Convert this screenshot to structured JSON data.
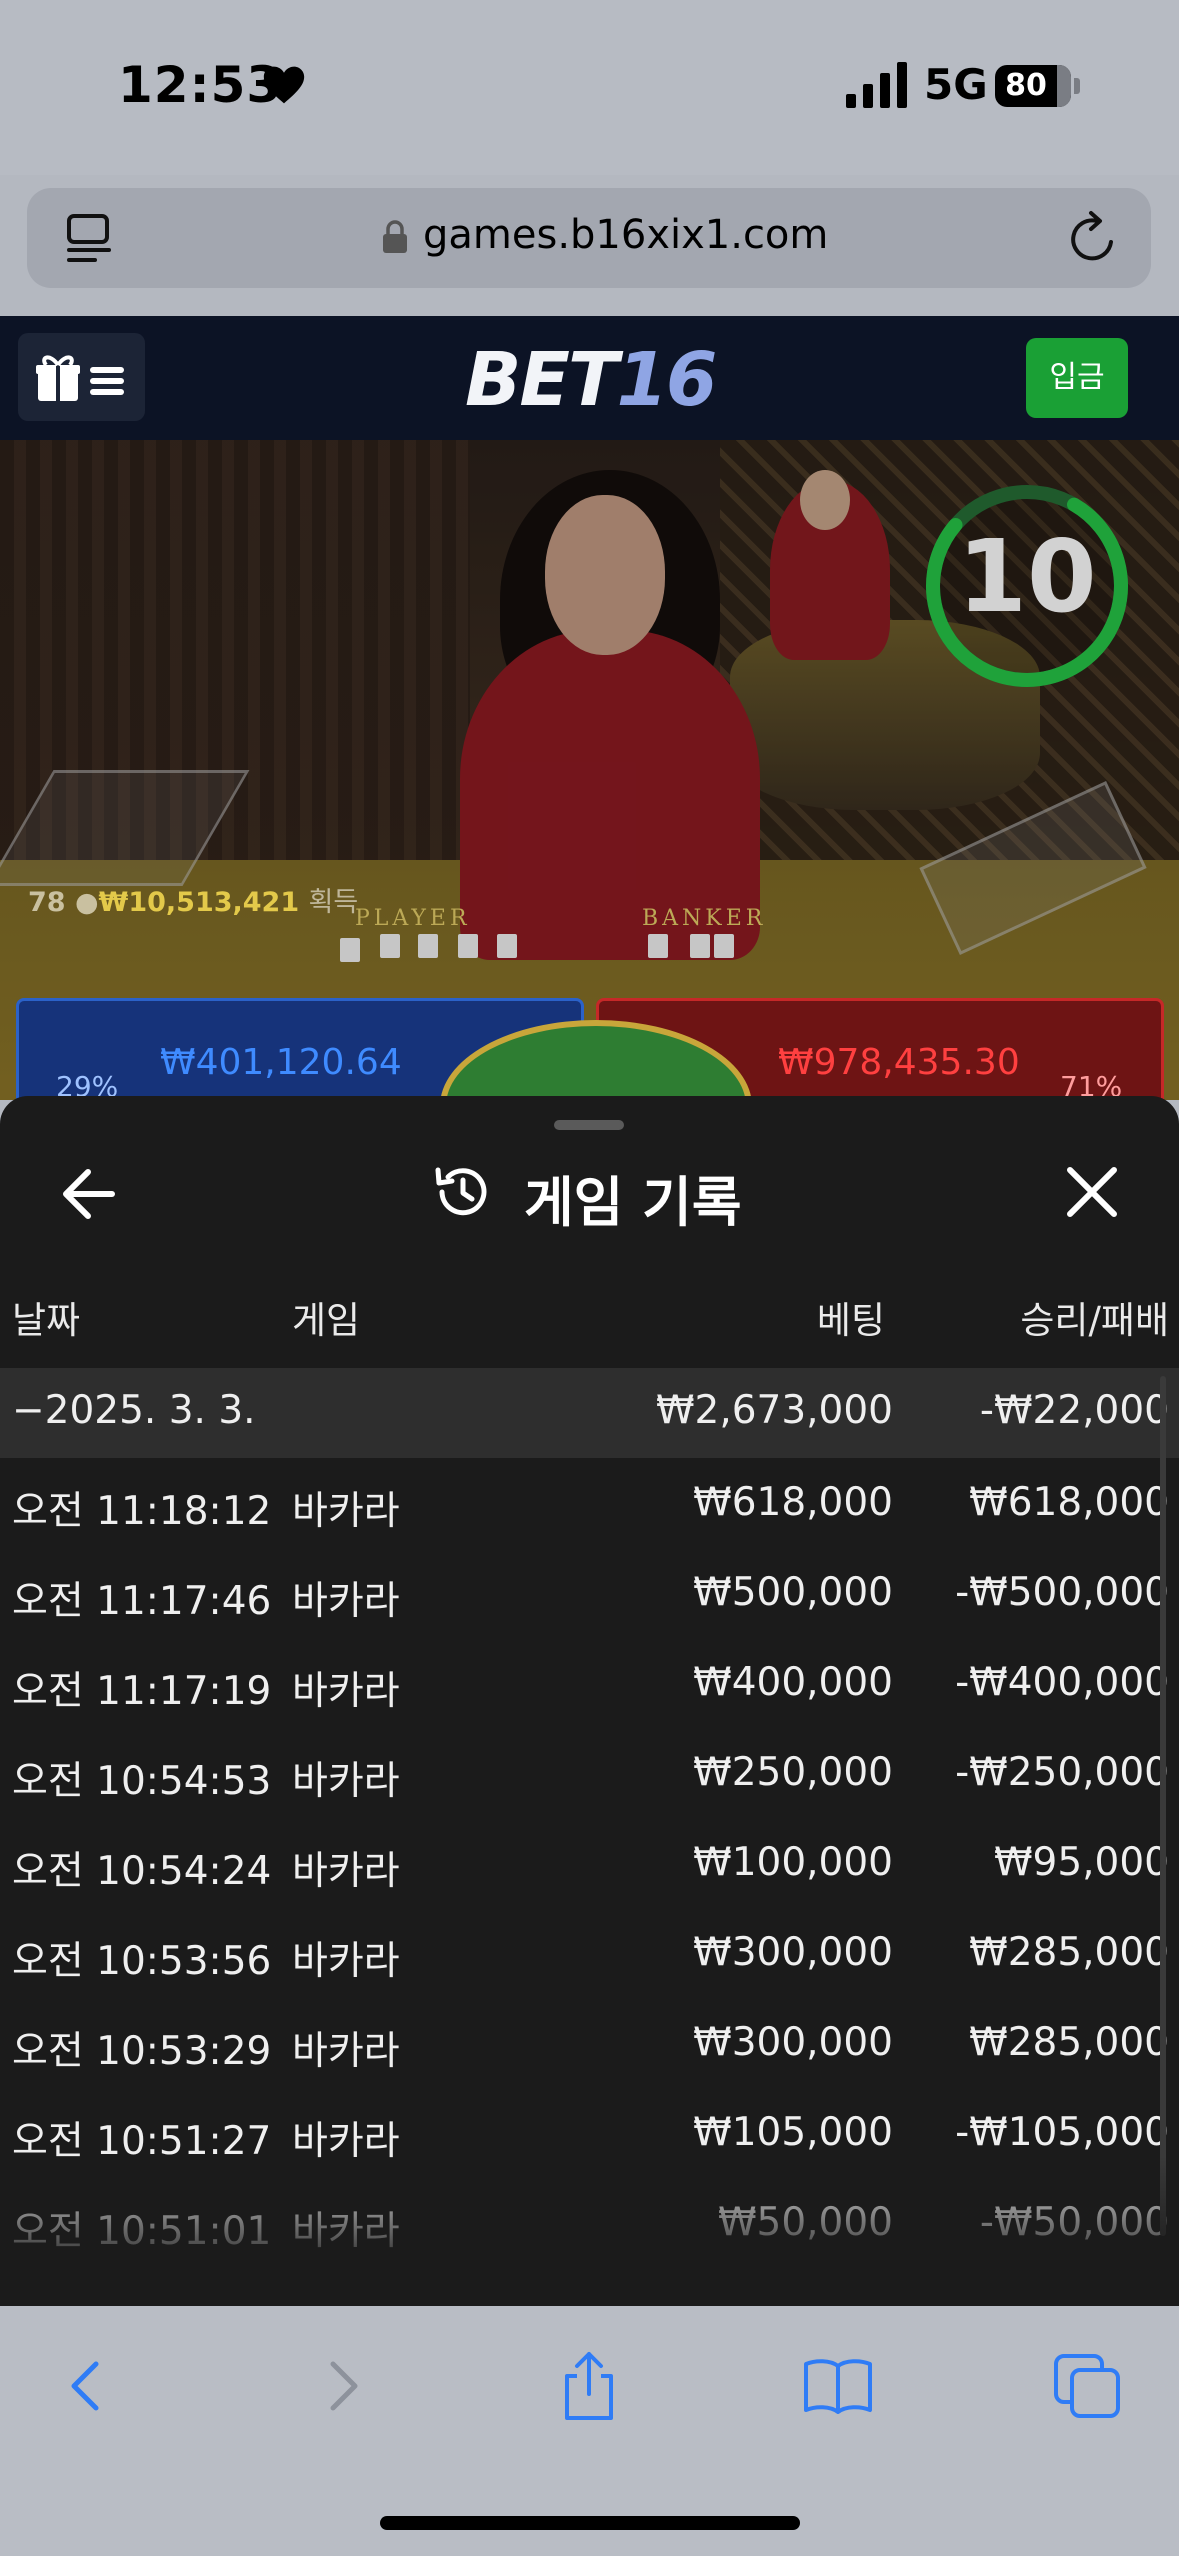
{
  "status_bar": {
    "time": "12:53",
    "network": "5G",
    "battery": "80"
  },
  "browser": {
    "url": "games.b16xix1.com"
  },
  "site_header": {
    "logo_part1": "BET",
    "logo_part2": "16",
    "deposit_label": "입금"
  },
  "game_video": {
    "timer": "10",
    "winners_count": "78",
    "winners_amount": "₩10,513,421",
    "winners_label": "획득",
    "player_label": "PLAYER",
    "banker_label": "BANKER",
    "player_total": "₩401,120.64",
    "player_pct": "29%",
    "banker_total": "₩978,435.30",
    "banker_pct": "71%"
  },
  "history": {
    "title": "게임 기록",
    "columns": {
      "date": "날짜",
      "game": "게임",
      "bet": "베팅",
      "win_loss": "승리/패배"
    },
    "date_group": {
      "date": "−2025. 3. 3.",
      "bet": "₩2,673,000",
      "win_loss": "-₩22,000"
    },
    "rows": [
      {
        "time": "오전 11:18:12",
        "game": "바카라",
        "bet": "₩618,000",
        "result": "₩618,000"
      },
      {
        "time": "오전 11:17:46",
        "game": "바카라",
        "bet": "₩500,000",
        "result": "-₩500,000"
      },
      {
        "time": "오전 11:17:19",
        "game": "바카라",
        "bet": "₩400,000",
        "result": "-₩400,000"
      },
      {
        "time": "오전 10:54:53",
        "game": "바카라",
        "bet": "₩250,000",
        "result": "-₩250,000"
      },
      {
        "time": "오전 10:54:24",
        "game": "바카라",
        "bet": "₩100,000",
        "result": "₩95,000"
      },
      {
        "time": "오전 10:53:56",
        "game": "바카라",
        "bet": "₩300,000",
        "result": "₩285,000"
      },
      {
        "time": "오전 10:53:29",
        "game": "바카라",
        "bet": "₩300,000",
        "result": "₩285,000"
      },
      {
        "time": "오전 10:51:27",
        "game": "바카라",
        "bet": "₩105,000",
        "result": "-₩105,000"
      },
      {
        "time": "오전 10:51:01",
        "game": "바카라",
        "bet": "₩50,000",
        "result": "-₩50,000"
      }
    ]
  },
  "colors": {
    "accent_green": "#1aa035",
    "header_bg": "#0c1325",
    "sheet_bg": "#1b1b1b",
    "ios_blue": "#2f7cf6"
  },
  "icons": {
    "status": [
      "heart-icon",
      "signal-icon",
      "battery-icon"
    ],
    "browser": [
      "tabs-icon",
      "lock-icon",
      "reload-icon"
    ],
    "header": [
      "gift-icon",
      "menu-icon"
    ],
    "sheet": [
      "back-arrow-icon",
      "history-icon",
      "close-icon"
    ],
    "toolbar": [
      "back-icon",
      "forward-icon",
      "share-icon",
      "bookmarks-icon",
      "tabs-icon"
    ]
  }
}
